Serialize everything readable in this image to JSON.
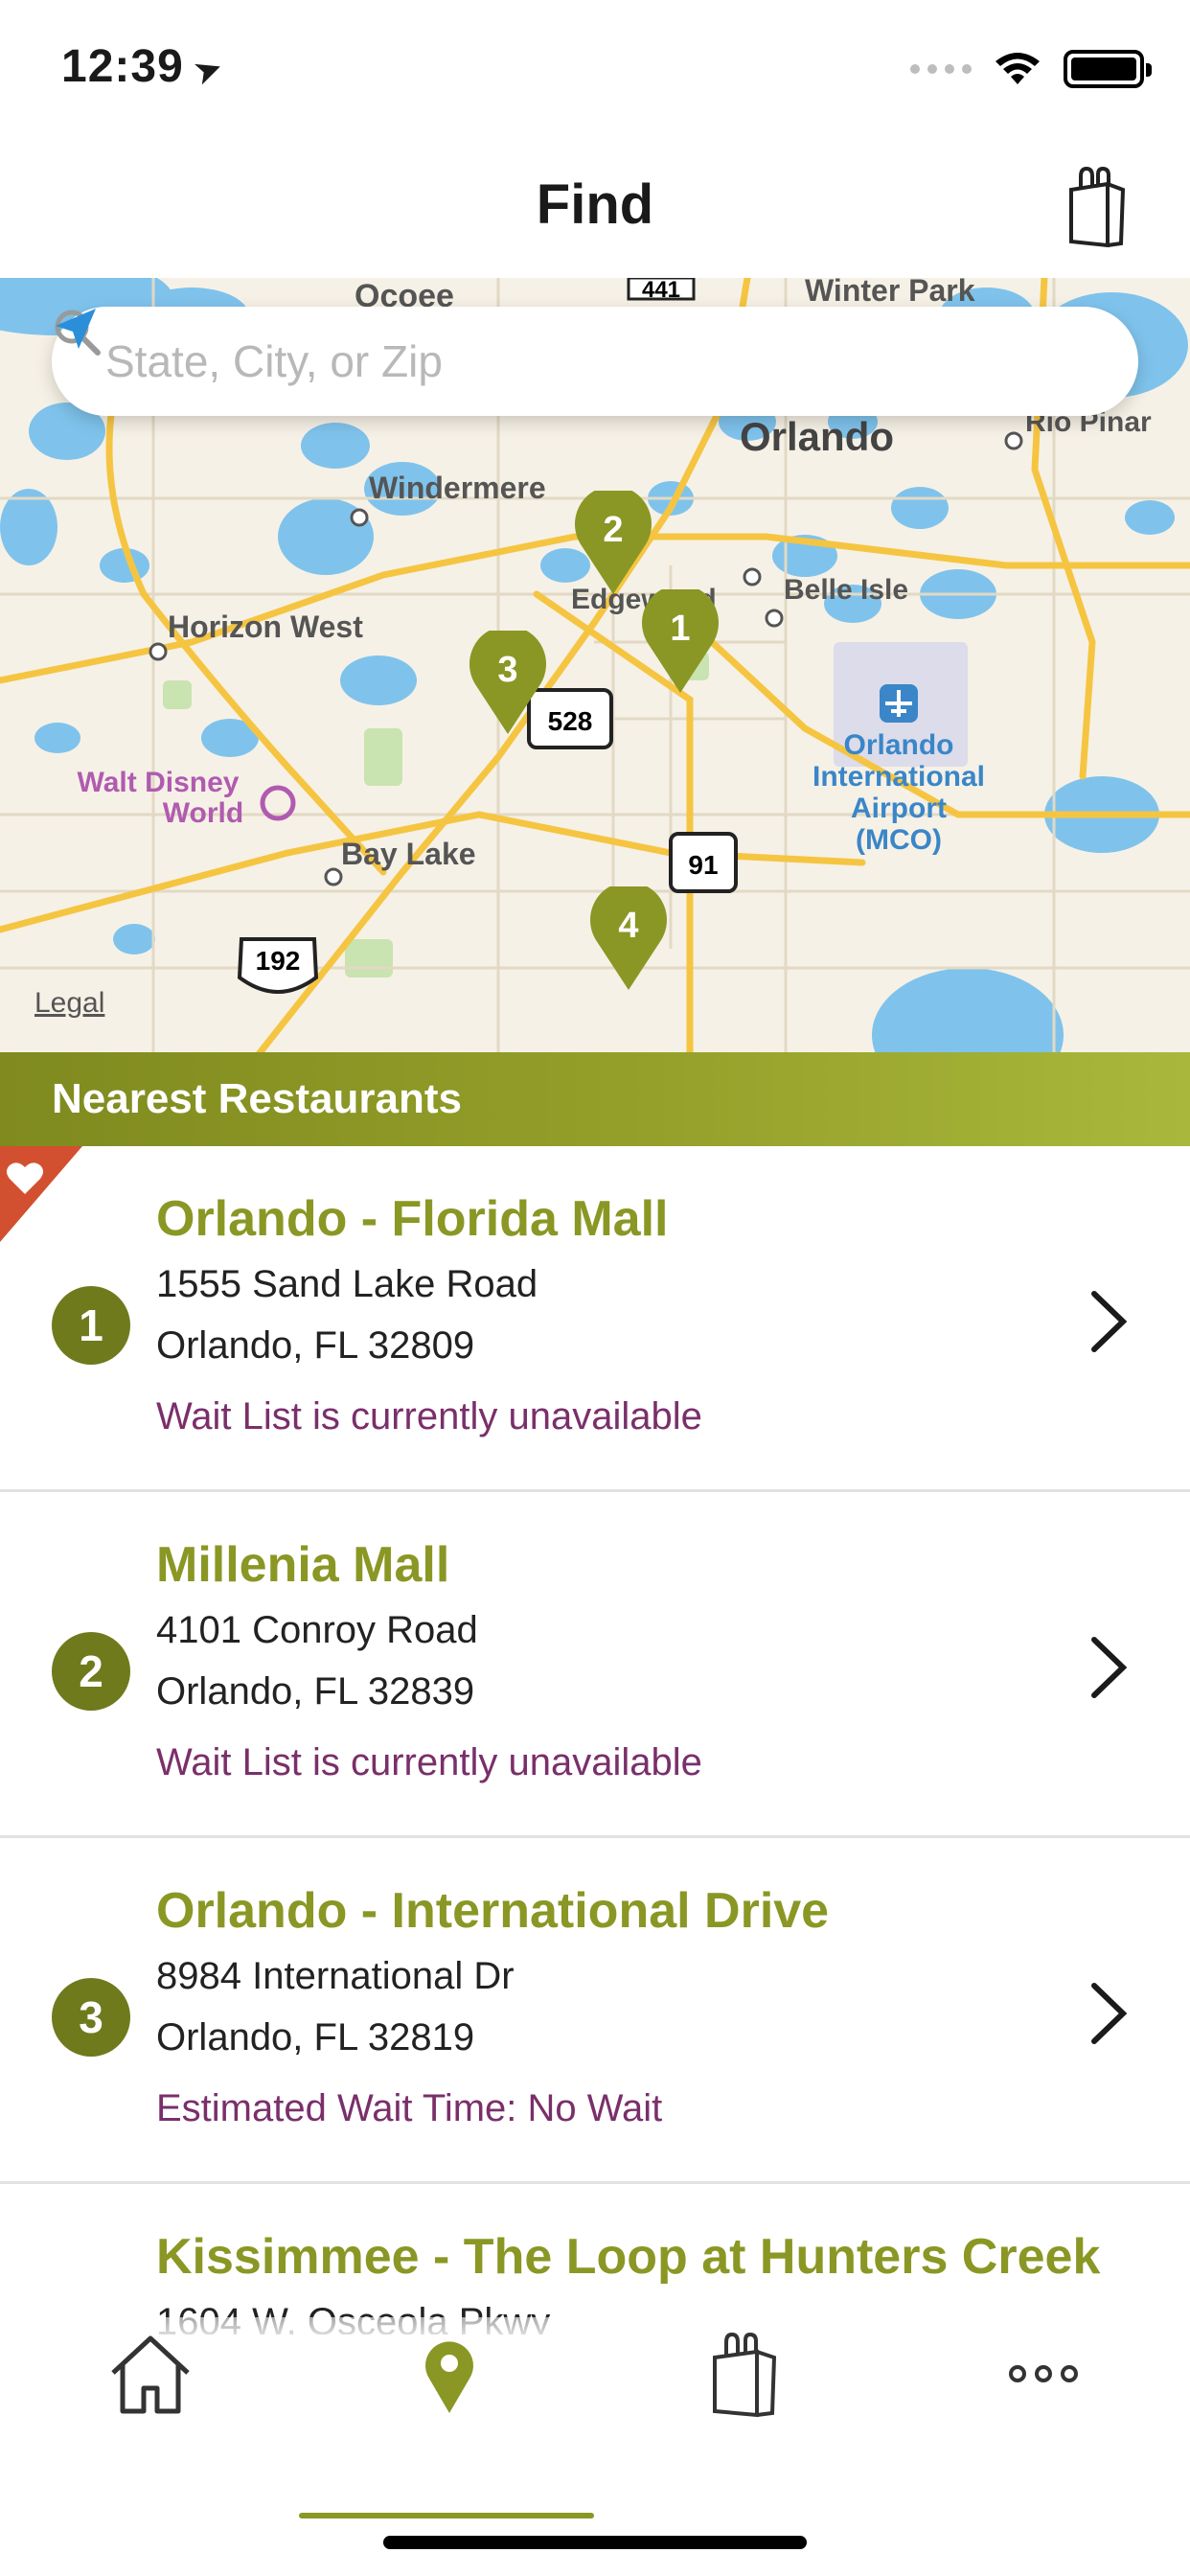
{
  "status_bar": {
    "time": "12:39",
    "location_glyph": "➤"
  },
  "nav": {
    "title": "Find",
    "bag_icon": "shopping-bag-icon"
  },
  "search": {
    "placeholder": "State, City, or Zip"
  },
  "map": {
    "legal": "Legal",
    "labels": [
      "Ocoee",
      "441",
      "Winter Park",
      "Orlando",
      "Rio Pinar",
      "Windermere",
      "Edgewood",
      "Belle Isle",
      "Horizon West",
      "528",
      "Orlando International Airport (MCO)",
      "Walt Disney World",
      "Bay Lake",
      "91",
      "192"
    ],
    "pins": [
      "1",
      "2",
      "3",
      "4"
    ]
  },
  "list_header": "Nearest Restaurants",
  "restaurants": [
    {
      "number": "1",
      "name": "Orlando - Florida Mall",
      "address1": "1555 Sand Lake Road",
      "address2": "Orlando, FL 32809",
      "wait": "Wait List is currently unavailable",
      "favorite": true
    },
    {
      "number": "2",
      "name": "Millenia Mall",
      "address1": "4101 Conroy Road",
      "address2": "Orlando, FL 32839",
      "wait": "Wait List is currently unavailable",
      "favorite": false
    },
    {
      "number": "3",
      "name": "Orlando - International Drive",
      "address1": "8984 International Dr",
      "address2": "Orlando, FL 32819",
      "wait": "Estimated Wait Time: No Wait",
      "favorite": false
    },
    {
      "number": "4",
      "name": "Kissimmee - The Loop at Hunters Creek",
      "address1": "1604 W. Osceola Pkwy",
      "address2": "",
      "wait": "",
      "favorite": false
    }
  ],
  "tabs": [
    {
      "name": "home",
      "icon": "home-icon",
      "active": false
    },
    {
      "name": "find",
      "icon": "location-pin-icon",
      "active": true
    },
    {
      "name": "order",
      "icon": "shopping-bag-icon",
      "active": false
    },
    {
      "name": "more",
      "icon": "more-dots-icon",
      "active": false
    }
  ],
  "colors": {
    "brand_green": "#8a9724",
    "badge_green": "#6f7a1c",
    "wait_purple": "#7a2f6a",
    "favorite_red": "#d2502f"
  }
}
